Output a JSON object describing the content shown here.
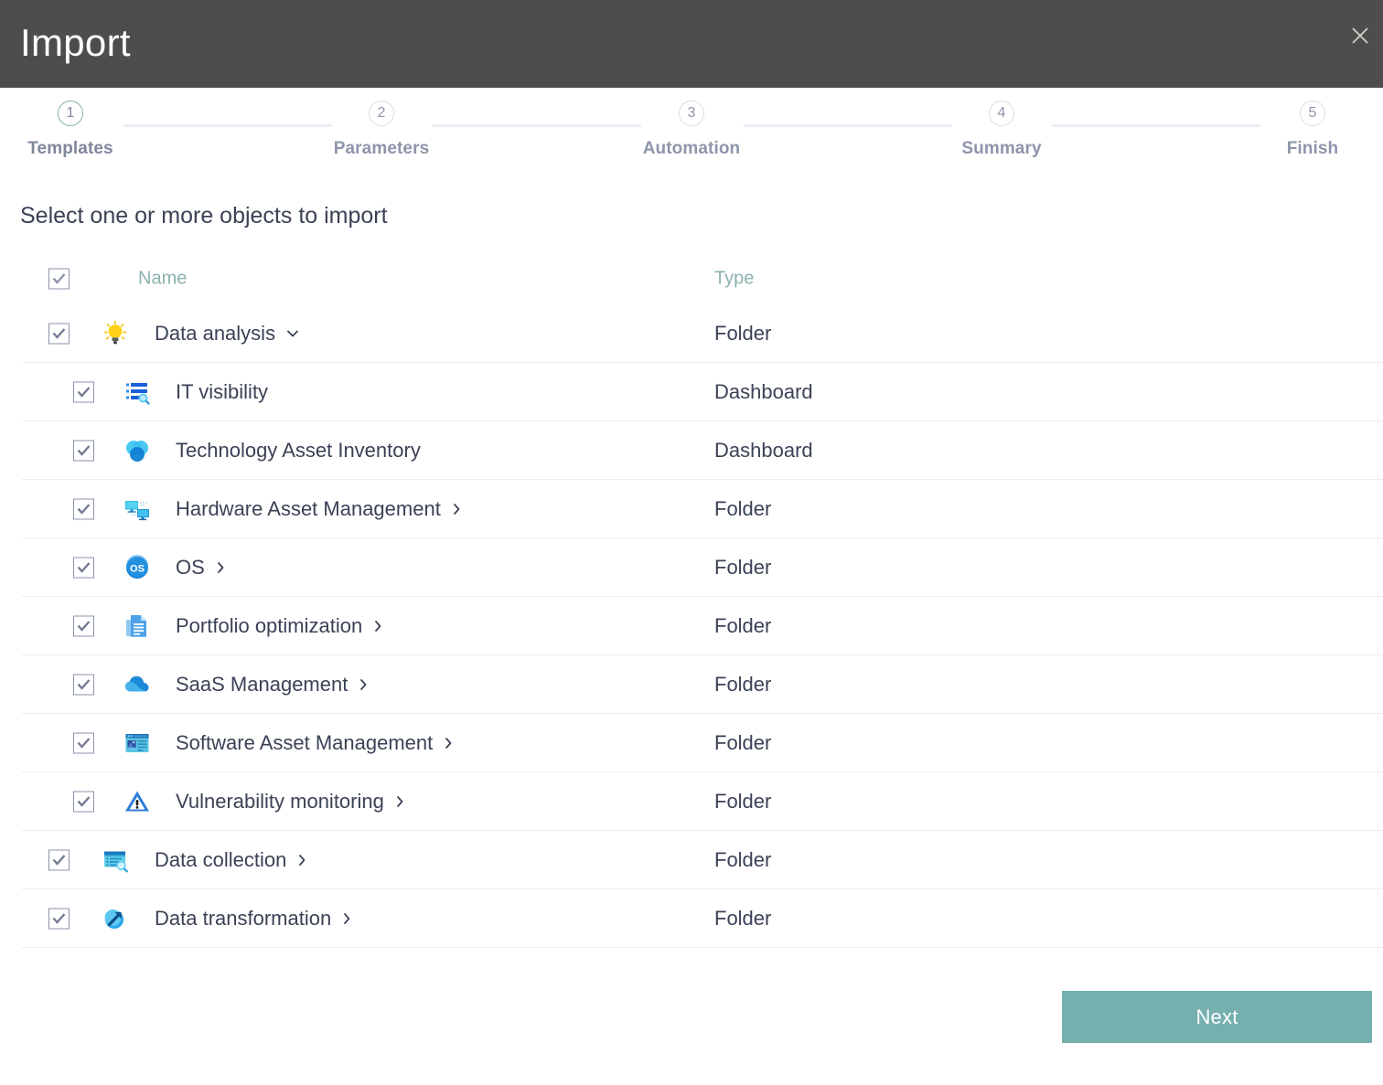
{
  "window": {
    "title": "Import",
    "close_icon": "close-icon",
    "header_bg": "#4d4d4d"
  },
  "stepper": {
    "active_color": "#7eb0ae",
    "inactive_color": "#8e95ab",
    "steps": [
      {
        "number": "1",
        "label": "Templates",
        "active": true
      },
      {
        "number": "2",
        "label": "Parameters",
        "active": false
      },
      {
        "number": "3",
        "label": "Automation",
        "active": false
      },
      {
        "number": "4",
        "label": "Summary",
        "active": false
      },
      {
        "number": "5",
        "label": "Finish",
        "active": false
      }
    ]
  },
  "main": {
    "instruction": "Select one or more objects to import",
    "columns": {
      "name": "Name",
      "type": "Type"
    },
    "select_all_checked": true,
    "rows": [
      {
        "name": "Data analysis",
        "type": "Folder",
        "icon": "lightbulb-icon",
        "level": 0,
        "checked": true,
        "expander": "chevron-down-icon"
      },
      {
        "name": "IT visibility",
        "type": "Dashboard",
        "icon": "list-search-icon",
        "level": 1,
        "checked": true,
        "expander": ""
      },
      {
        "name": "Technology Asset Inventory",
        "type": "Dashboard",
        "icon": "venn-circles-icon",
        "level": 1,
        "checked": true,
        "expander": ""
      },
      {
        "name": "Hardware Asset Management",
        "type": "Folder",
        "icon": "monitors-network-icon",
        "level": 1,
        "checked": true,
        "expander": "chevron-right-icon"
      },
      {
        "name": "OS",
        "type": "Folder",
        "icon": "os-badge-icon",
        "level": 1,
        "checked": true,
        "expander": "chevron-right-icon"
      },
      {
        "name": "Portfolio optimization",
        "type": "Folder",
        "icon": "documents-icon",
        "level": 1,
        "checked": true,
        "expander": "chevron-right-icon"
      },
      {
        "name": "SaaS Management",
        "type": "Folder",
        "icon": "cloud-icon",
        "level": 1,
        "checked": true,
        "expander": "chevron-right-icon"
      },
      {
        "name": "Software Asset Management",
        "type": "Folder",
        "icon": "window-app-icon",
        "level": 1,
        "checked": true,
        "expander": "chevron-right-icon"
      },
      {
        "name": "Vulnerability monitoring",
        "type": "Folder",
        "icon": "warning-triangle-icon",
        "level": 1,
        "checked": true,
        "expander": "chevron-right-icon"
      },
      {
        "name": "Data collection",
        "type": "Folder",
        "icon": "window-search-icon",
        "level": 0,
        "checked": true,
        "expander": "chevron-right-icon"
      },
      {
        "name": "Data transformation",
        "type": "Folder",
        "icon": "arrow-circle-icon",
        "level": 0,
        "checked": true,
        "expander": "chevron-right-icon"
      }
    ]
  },
  "footer": {
    "next_label": "Next",
    "next_color": "#75b0af"
  }
}
